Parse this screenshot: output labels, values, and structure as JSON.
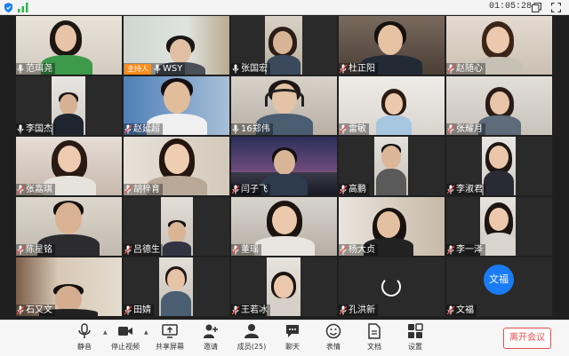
{
  "topbar": {
    "timer": "01:05:28"
  },
  "participants": [
    {
      "name": "范珥尧",
      "mic": "on"
    },
    {
      "name": "WSY",
      "mic": "on",
      "host_label": "主持人"
    },
    {
      "name": "张国宏",
      "mic": "on"
    },
    {
      "name": "杜正阳",
      "mic": "off"
    },
    {
      "name": "赵随心",
      "mic": "off"
    },
    {
      "name": "李国杰",
      "mic": "on"
    },
    {
      "name": "赵延超",
      "mic": "off"
    },
    {
      "name": "16郑伟",
      "mic": "on"
    },
    {
      "name": "雷敏",
      "mic": "off"
    },
    {
      "name": "张耀月",
      "mic": "off"
    },
    {
      "name": "张嘉琪",
      "mic": "off"
    },
    {
      "name": "胡梓育",
      "mic": "off"
    },
    {
      "name": "闫子飞",
      "mic": "off"
    },
    {
      "name": "高鹏",
      "mic": "off"
    },
    {
      "name": "李淑君",
      "mic": "off"
    },
    {
      "name": "陈星铭",
      "mic": "off"
    },
    {
      "name": "吕德生",
      "mic": "off"
    },
    {
      "name": "董瑶",
      "mic": "off"
    },
    {
      "name": "杨大贞",
      "mic": "off"
    },
    {
      "name": "李一泽",
      "mic": "off"
    },
    {
      "name": "石又文",
      "mic": "off"
    },
    {
      "name": "田婧",
      "mic": "off"
    },
    {
      "name": "王若冰",
      "mic": "off"
    },
    {
      "name": "孔洪新",
      "mic": "off"
    },
    {
      "name": "文福",
      "mic": "off",
      "avatar_text": "文福"
    }
  ],
  "toolbar": {
    "mute": "静音",
    "stop_video": "停止视频",
    "share_screen": "共享屏幕",
    "invite": "邀请",
    "members": "成员(25)",
    "chat": "聊天",
    "emoji": "表情",
    "docs": "文档",
    "settings": "设置",
    "leave": "离开会议"
  },
  "colors": {
    "accent": "#1a7cf5",
    "host_badge": "#ff8c1a",
    "leave": "#e34d4d"
  }
}
